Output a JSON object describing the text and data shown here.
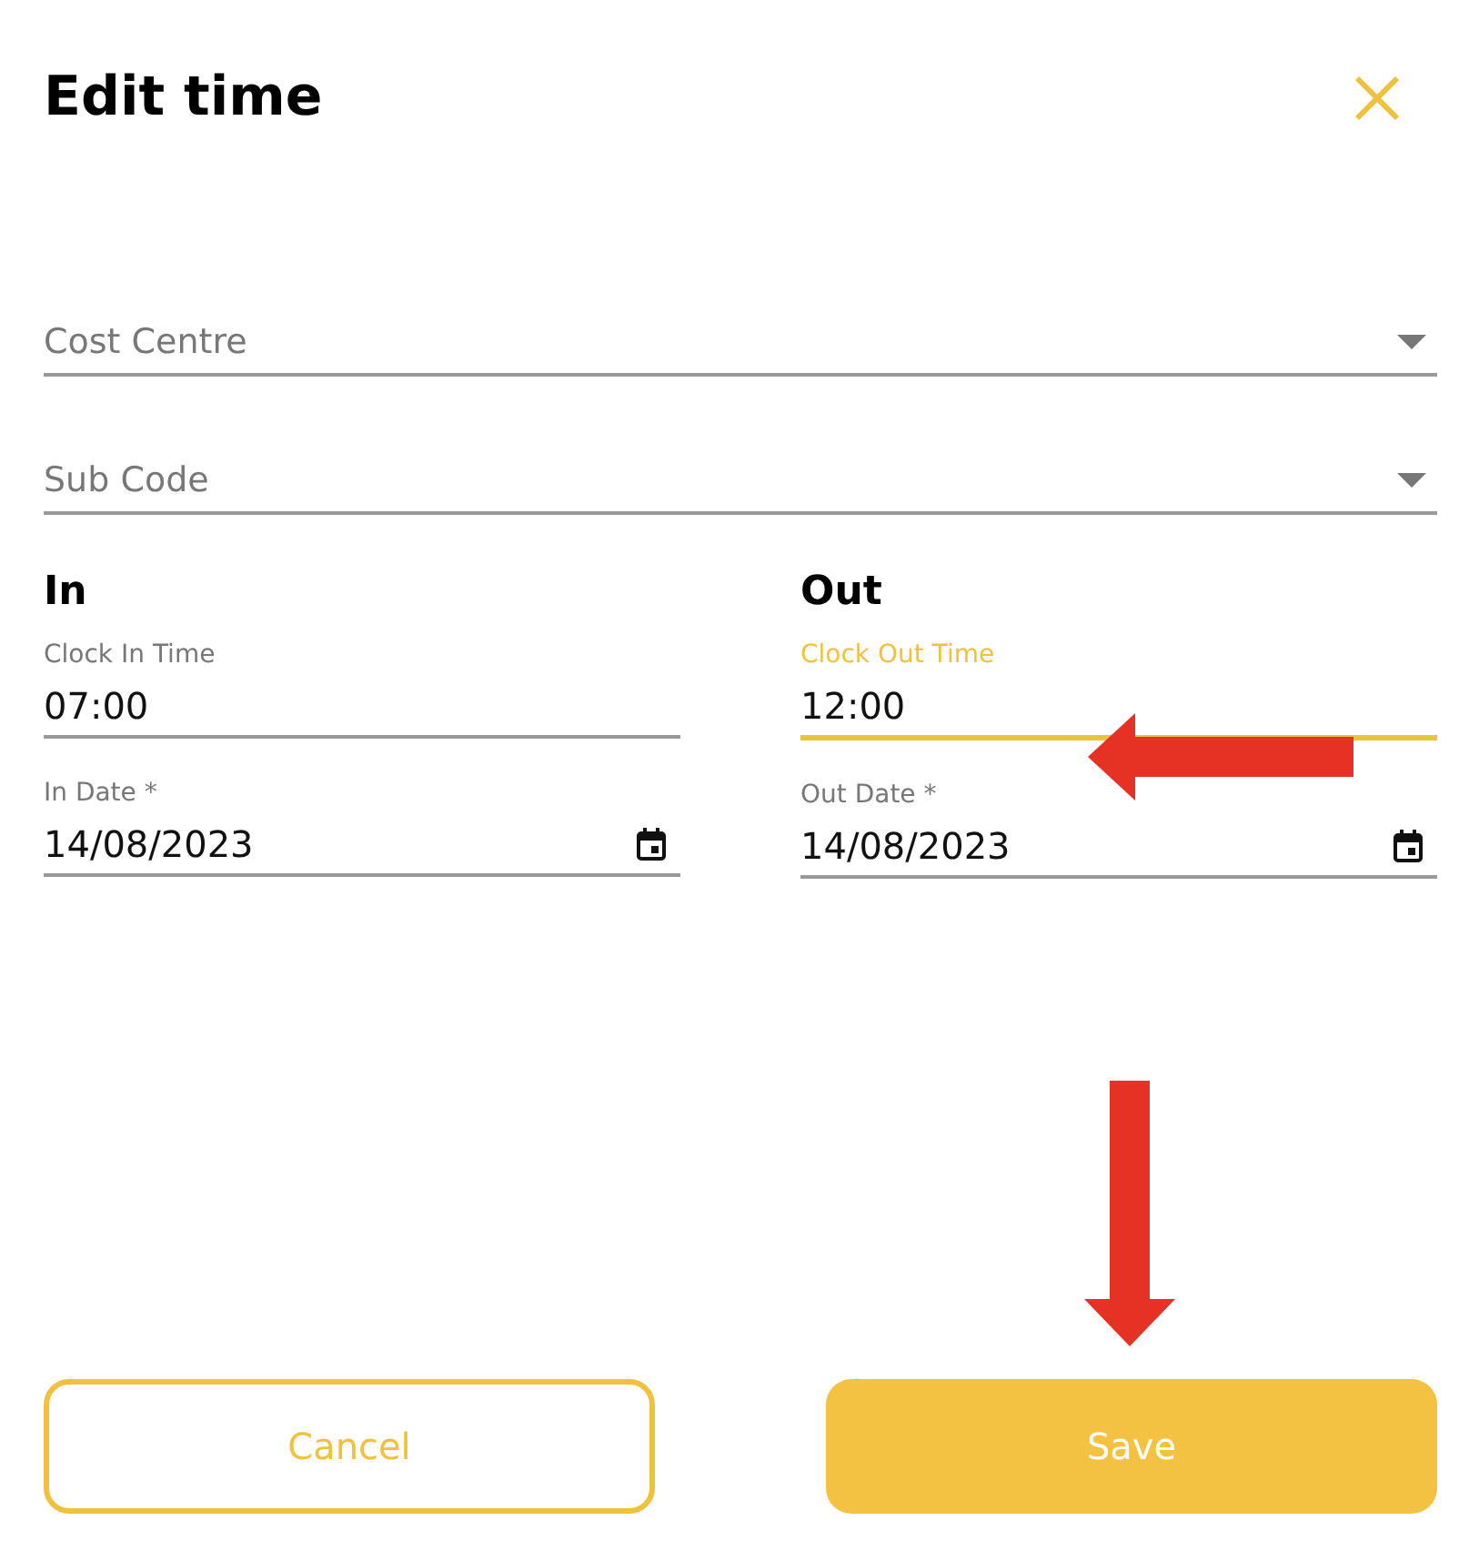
{
  "title": "Edit time",
  "selects": [
    {
      "placeholder": "Cost Centre"
    },
    {
      "placeholder": "Sub Code"
    }
  ],
  "columns": [
    {
      "heading": "In",
      "time": {
        "label": "Clock In Time",
        "value": "07:00",
        "focused": false
      },
      "date": {
        "label": "In Date *",
        "value": "14/08/2023"
      }
    },
    {
      "heading": "Out",
      "time": {
        "label": "Clock Out Time",
        "value": "12:00",
        "focused": true
      },
      "date": {
        "label": "Out Date *",
        "value": "14/08/2023"
      }
    }
  ],
  "buttons": [
    {
      "label": "Cancel",
      "kind": "outline"
    },
    {
      "label": "Save",
      "kind": "filled"
    }
  ]
}
